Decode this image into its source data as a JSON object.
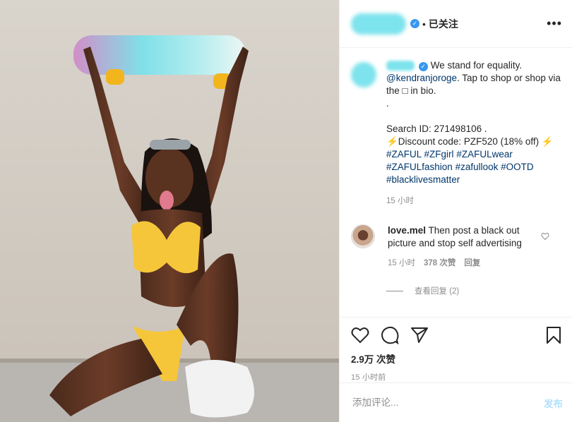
{
  "header": {
    "follow_status": "已关注",
    "dot": "•",
    "more": "•••"
  },
  "caption": {
    "text_1": "We stand for equality.",
    "mention": "@kendranjoroge",
    "text_2": ". Tap to shop or shop via the □ in bio.",
    "dot_line": ".",
    "search_id": "Search ID: 271498106 .",
    "discount": "⚡Discount code: PZF520 (18% off) ⚡",
    "hashtags": [
      "#ZAFUL",
      "#ZFgirl",
      "#ZAFULwear",
      "#ZAFULfashion",
      "#zafullook",
      "#OOTD",
      "#blacklivesmatter"
    ],
    "time": "15 小时"
  },
  "comment": {
    "username": "love.mel",
    "text": "Then post a black out picture and stop self advertising",
    "time": "15 小时",
    "likes": "378 次赞",
    "reply": "回复",
    "view_replies": "查看回复 (2)"
  },
  "actions": {
    "likes": "2.9万 次赞",
    "ago": "15 小时前"
  },
  "add_comment": {
    "placeholder": "添加评论...",
    "post": "发布"
  },
  "colors": {
    "accent": "#3897f0",
    "post_disabled": "#b2dffc",
    "bikini": "#f5c63a",
    "blur": "#7de3ec"
  }
}
